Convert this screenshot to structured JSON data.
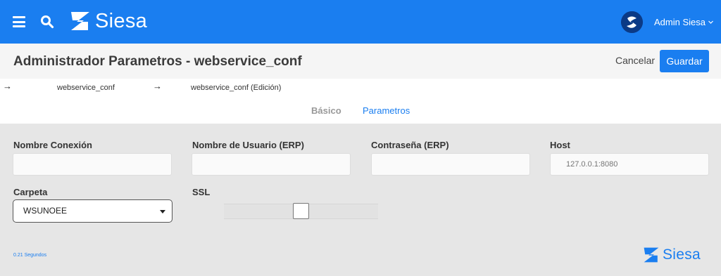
{
  "header": {
    "brand": "Siesa",
    "user_name": "Admin Siesa",
    "icons": [
      "menu-icon",
      "search-icon",
      "siesa-logo",
      "user-avatar",
      "chevron-down-icon"
    ]
  },
  "titlebar": {
    "title": "Administrador Parametros - webservice_conf",
    "cancel_label": "Cancelar",
    "save_label": "Guardar"
  },
  "breadcrumb": {
    "items": [
      "webservice_conf",
      "webservice_conf (Edición)"
    ],
    "separator": "→"
  },
  "tabs": [
    {
      "label": "Básico",
      "active": false
    },
    {
      "label": "Parametros",
      "active": true
    }
  ],
  "form": {
    "connection_name": {
      "label": "Nombre Conexión",
      "value": ""
    },
    "erp_user": {
      "label": "Nombre de Usuario (ERP)",
      "value": ""
    },
    "erp_password": {
      "label": "Contraseña (ERP)",
      "value": ""
    },
    "host": {
      "label": "Host",
      "placeholder": "127.0.0.1:8080",
      "value": ""
    },
    "folder": {
      "label": "Carpeta",
      "selected": "WSUNOEE"
    },
    "ssl": {
      "label": "SSL",
      "checked": false
    }
  },
  "footer": {
    "elapsed": "0.21 Segundos",
    "brand": "Siesa"
  },
  "colors": {
    "primary": "#1a7ef0",
    "avatar": "#0b3a86",
    "background": "#e6e6e6"
  }
}
